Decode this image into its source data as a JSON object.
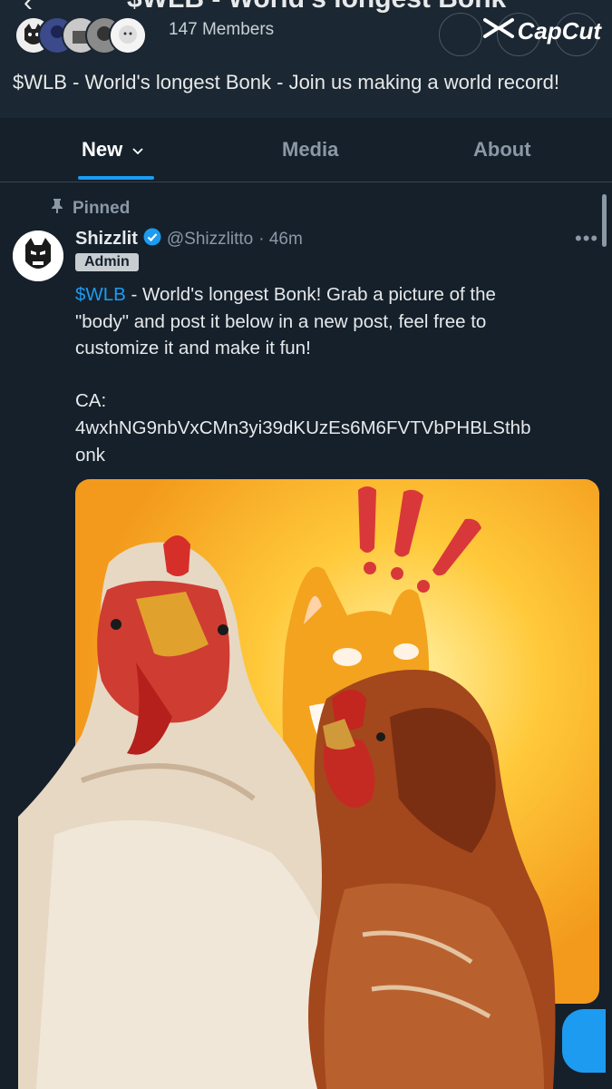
{
  "header": {
    "title": "$WLB - World's longest Bonk",
    "members": "147 Members",
    "description": "$WLB - World's longest Bonk - Join us making a world record!",
    "watermark": "CapCut"
  },
  "tabs": [
    {
      "label": "New",
      "active": true
    },
    {
      "label": "Media",
      "active": false
    },
    {
      "label": "About",
      "active": false
    }
  ],
  "post": {
    "pinned_label": "Pinned",
    "author": "Shizzlit",
    "handle": "@Shizzlitto",
    "time": "· 46m",
    "badge": "Admin",
    "cashtag": "$WLB",
    "text_line1": " - World's longest Bonk! Grab a picture of the",
    "text_line2": "\"body\" and post it below in a new post, feel free to",
    "text_line3": "customize it and make it fun!",
    "ca_label": "CA:",
    "ca_value_1": "4wxhNG9nbVxCMn3yi39dKUzEs6M6FVTVbPHBLSthb",
    "ca_value_2": "onk",
    "more_icon": "more-dots-icon"
  },
  "colors": {
    "background": "#15202b",
    "header": "#1b2732",
    "accent": "#1d9bf0",
    "muted": "#8b98a5",
    "media_bg": "#f5a623"
  }
}
